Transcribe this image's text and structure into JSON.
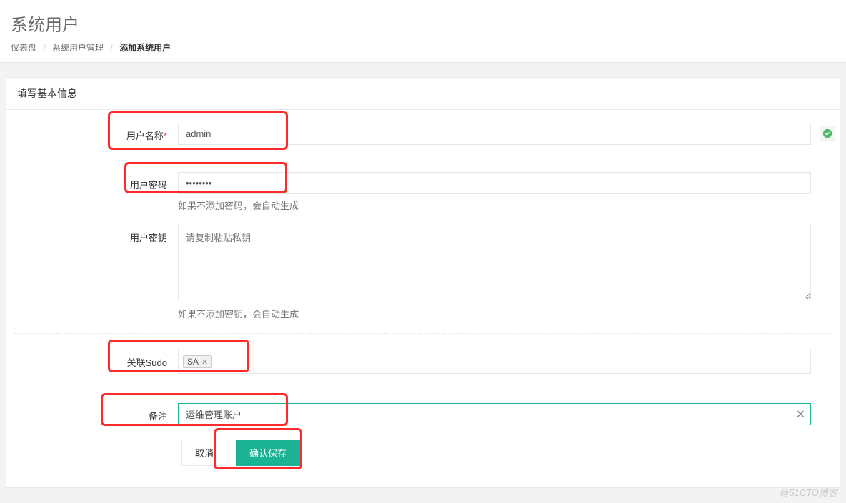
{
  "header": {
    "title": "系统用户",
    "breadcrumbs": [
      "仪表盘",
      "系统用户管理",
      "添加系统用户"
    ]
  },
  "panel": {
    "title": "填写基本信息"
  },
  "form": {
    "username": {
      "label": "用户名称",
      "value": "admin"
    },
    "password": {
      "label": "用户密码",
      "value": "••••••••",
      "help": "如果不添加密码，会自动生成"
    },
    "privatekey": {
      "label": "用户密钥",
      "placeholder": "请复制粘贴私钥",
      "value": "",
      "help": "如果不添加密钥，会自动生成"
    },
    "sudo": {
      "label": "关联Sudo",
      "tags": [
        "SA"
      ]
    },
    "remark": {
      "label": "备注",
      "value": "运维管理账户"
    }
  },
  "actions": {
    "cancel": "取消",
    "save": "确认保存"
  },
  "watermark": "@51CTO博客"
}
